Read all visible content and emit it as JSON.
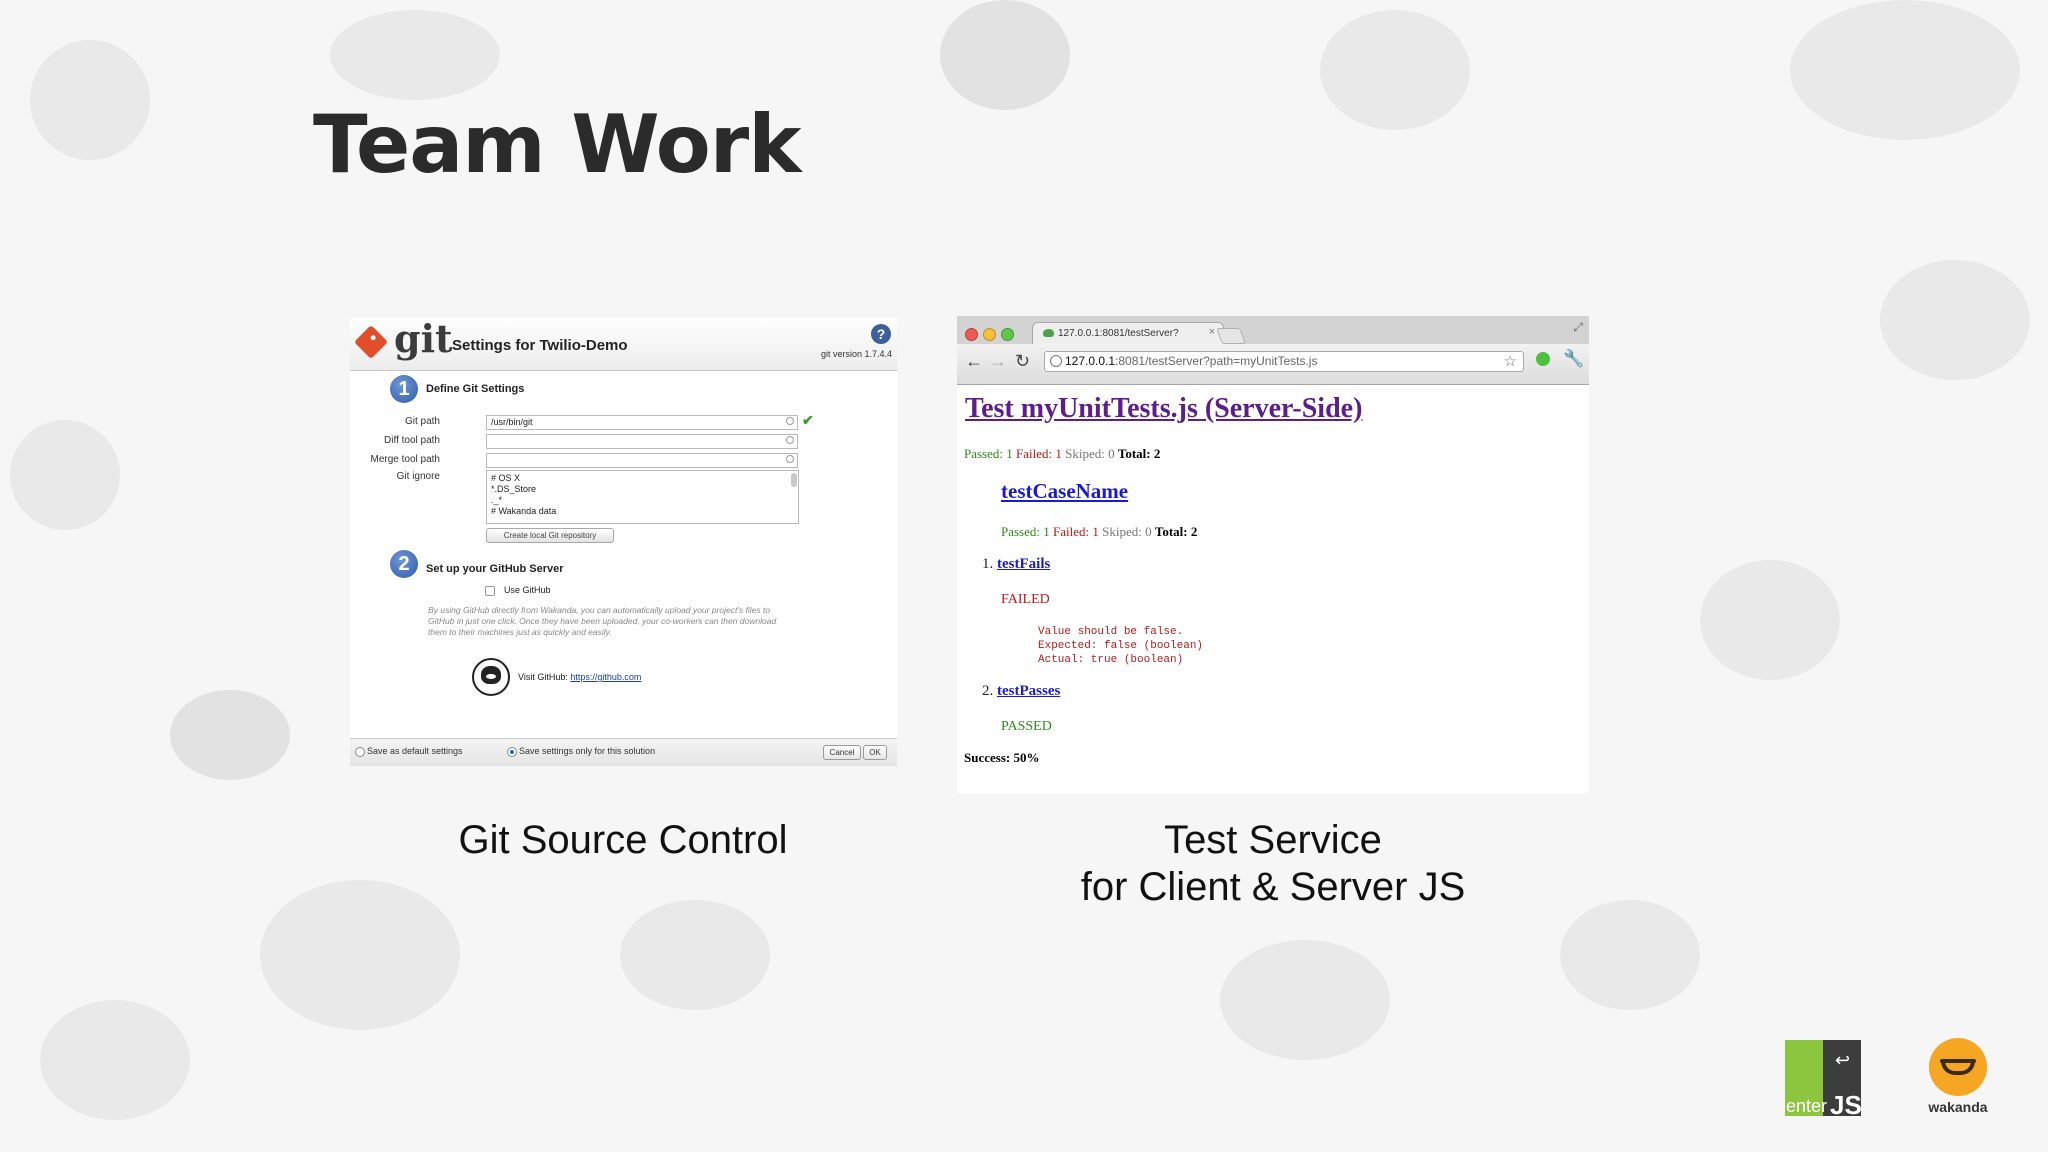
{
  "slide": {
    "title": "Team Work",
    "captions": {
      "git": "Git Source Control",
      "test_line1": "Test Service",
      "test_line2": "for Client & Server JS"
    }
  },
  "git_dialog": {
    "logo_text": "git",
    "title": "Settings for Twilio-Demo",
    "help_icon": "?",
    "version": "git version 1.7.4.4",
    "step1": {
      "number": "1",
      "title": "Define Git Settings"
    },
    "fields": {
      "git_path_label": "Git path",
      "git_path_value": "/usr/bin/git",
      "diff_label": "Diff tool path",
      "diff_value": "",
      "merge_label": "Merge tool path",
      "merge_value": "",
      "ignore_label": "Git ignore",
      "ignore_lines": [
        "# OS X",
        "*.DS_Store",
        "._*",
        "# Wakanda data"
      ]
    },
    "create_repo_button": "Create local Git repository",
    "step2": {
      "number": "2",
      "title": "Set up your GitHub Server"
    },
    "use_github_label": "Use GitHub",
    "description": "By using GitHub directly from Wakanda, you can automatically upload your project's files to GitHub in just one click. Once they have been uploaded, your co-workers can then download them to their machines just as quickly and easily.",
    "visit_label": "Visit GitHub:",
    "visit_link": "https://github.com",
    "footer": {
      "save_default": "Save as default settings",
      "save_solution": "Save settings only for this solution",
      "cancel": "Cancel",
      "ok": "OK"
    }
  },
  "browser": {
    "tab_title": "127.0.0.1:8081/testServer?",
    "tab_close": "×",
    "url_host": "127.0.0.1",
    "url_rest": ":8081/testServer?path=myUnitTests.js",
    "icons": [
      "back-icon",
      "forward-icon",
      "reload-icon",
      "star-icon",
      "extension-icon",
      "wrench-icon"
    ],
    "page": {
      "heading": "Test myUnitTests.js (Server-Side)",
      "summary": {
        "passed": "Passed: 1",
        "failed": "Failed: 1",
        "skipped": "Skiped: 0",
        "total": "Total: 2"
      },
      "case_name": "testCaseName",
      "case_summary": {
        "passed": "Passed: 1",
        "failed": "Failed: 1",
        "skipped": "Skiped: 0",
        "total": "Total: 2"
      },
      "tests": [
        {
          "num": "1.",
          "name": "testFails",
          "status": "FAILED"
        },
        {
          "num": "2.",
          "name": "testPasses",
          "status": "PASSED"
        }
      ],
      "failure_message": "Value should be false.\nExpected: false (boolean)\nActual: true (boolean)",
      "success": "Success: 50%"
    }
  },
  "logos": {
    "enterjs_enter": "enter",
    "enterjs_js": "JS",
    "wakanda": "wakanda"
  },
  "colors": {
    "git_red": "#e04e2b",
    "pass_green": "#2f8a1c",
    "fail_red": "#c01818",
    "heading_purple": "#5b1e8c",
    "link_blue": "#1a1ad6",
    "enterjs_green": "#8cc63f",
    "wakanda_orange": "#f5a623"
  }
}
